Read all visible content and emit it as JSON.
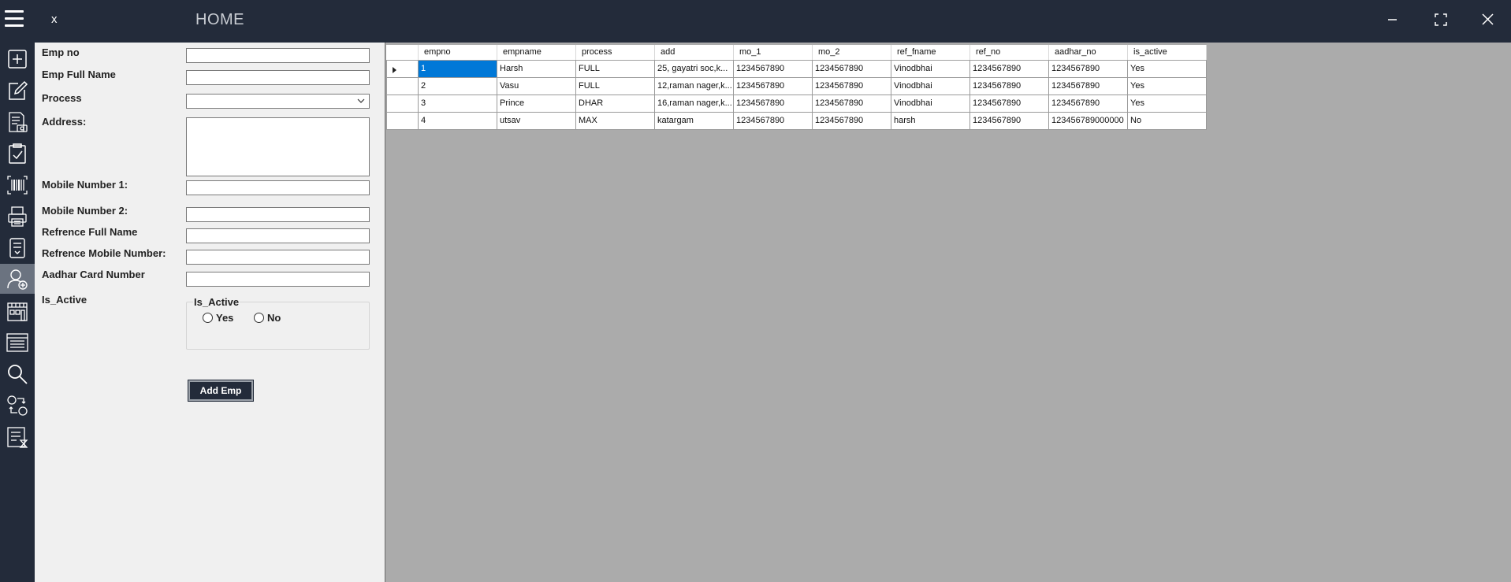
{
  "titlebar": {
    "close_label": "x",
    "title": "HOME"
  },
  "sidebar": {
    "items": [
      {
        "name": "add-icon"
      },
      {
        "name": "edit-icon"
      },
      {
        "name": "invoice-icon"
      },
      {
        "name": "clipboard-check-icon"
      },
      {
        "name": "barcode-icon"
      },
      {
        "name": "printer-icon"
      },
      {
        "name": "document-list-icon"
      },
      {
        "name": "add-user-icon",
        "active": true
      },
      {
        "name": "building-icon"
      },
      {
        "name": "table-list-icon"
      },
      {
        "name": "search-icon"
      },
      {
        "name": "exchange-icon"
      },
      {
        "name": "report-icon"
      }
    ]
  },
  "form": {
    "emp_no_label": "Emp no",
    "emp_full_name_label": "Emp Full Name",
    "process_label": "Process",
    "address_label": "Address:",
    "mobile1_label": "Mobile Number 1:",
    "mobile2_label": "Mobile Number 2:",
    "ref_name_label": "Refrence Full Name",
    "ref_mobile_label": "Refrence Mobile Number:",
    "aadhar_label": "Aadhar Card Number",
    "is_active_label": "Is_Active",
    "group_title": "Is_Active",
    "radio_yes": "Yes",
    "radio_no": "No",
    "add_button": "Add Emp"
  },
  "grid": {
    "columns": [
      "empno",
      "empname",
      "process",
      "add",
      "mo_1",
      "mo_2",
      "ref_fname",
      "ref_no",
      "aadhar_no",
      "is_active"
    ],
    "rows": [
      [
        "1",
        "Harsh",
        "FULL",
        "25, gayatri soc,k...",
        "1234567890",
        "1234567890",
        "Vinodbhai",
        "1234567890",
        "1234567890",
        "Yes"
      ],
      [
        "2",
        "Vasu",
        "FULL",
        "12,raman nager,k...",
        "1234567890",
        "1234567890",
        "Vinodbhai",
        "1234567890",
        "1234567890",
        "Yes"
      ],
      [
        "3",
        "Prince",
        "DHAR",
        "16,raman nager,k...",
        "1234567890",
        "1234567890",
        "Vinodbhai",
        "1234567890",
        "1234567890",
        "Yes"
      ],
      [
        "4",
        "utsav",
        "MAX",
        "katargam",
        "1234567890",
        "1234567890",
        "harsh",
        "1234567890",
        "123456789000000",
        "No"
      ]
    ]
  },
  "colors": {
    "titlebar_bg": "#232b3a",
    "selected_cell": "#0078d7",
    "grid_bg": "#ababab"
  }
}
